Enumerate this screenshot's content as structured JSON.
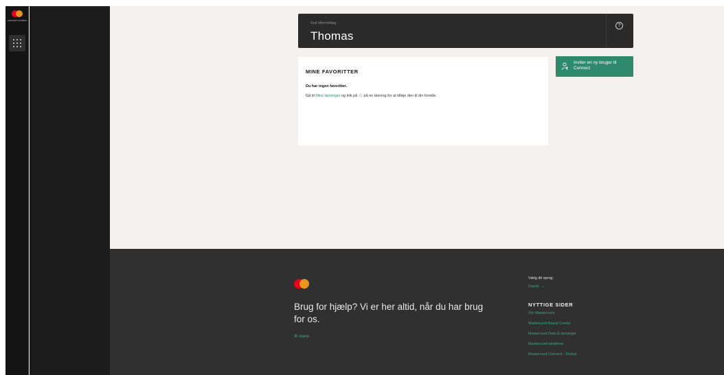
{
  "app": {
    "logo_text": "connect nordics"
  },
  "header": {
    "greeting_label": "God eftermiddag",
    "user_name": "Thomas",
    "help_glyph": "?"
  },
  "favorites": {
    "title": "MINE FAVORITTER",
    "empty_title": "Du har ingen favoritter.",
    "desc_pre": "Gå til ",
    "desc_link": "Mine løsninger",
    "desc_mid": " og klik på ",
    "star_glyph": "☆",
    "desc_post": " på en løsning for at tilføje den til din forside."
  },
  "invite": {
    "label": "Inviter en ny bruger til Connect",
    "icon": "add-user-icon"
  },
  "footer": {
    "headline": "Brug for hjælp? Vi er her altid, når du har brug for os.",
    "help_icon_glyph": "⚙",
    "help_link": "Hjælp",
    "language_label": "Vælg dit sprog:",
    "language_value": "Dansk",
    "language_chevron": "⌄",
    "useful_pages_title": "NYTTIGE SIDER",
    "links": [
      "Om Mastercard",
      "Mastercard Brand Center",
      "Mastercard Data & løsninger",
      "Mastercard-udviklere",
      "Mastercard Connect - Global"
    ]
  },
  "colors": {
    "accent": "#2e8a6d",
    "link_green": "#3ea584",
    "mc_red": "#eb001b",
    "mc_orange": "#f79e1b",
    "rail_bg": "#141414",
    "footer_bg": "#303030",
    "page_bg": "#f3f0ed"
  }
}
